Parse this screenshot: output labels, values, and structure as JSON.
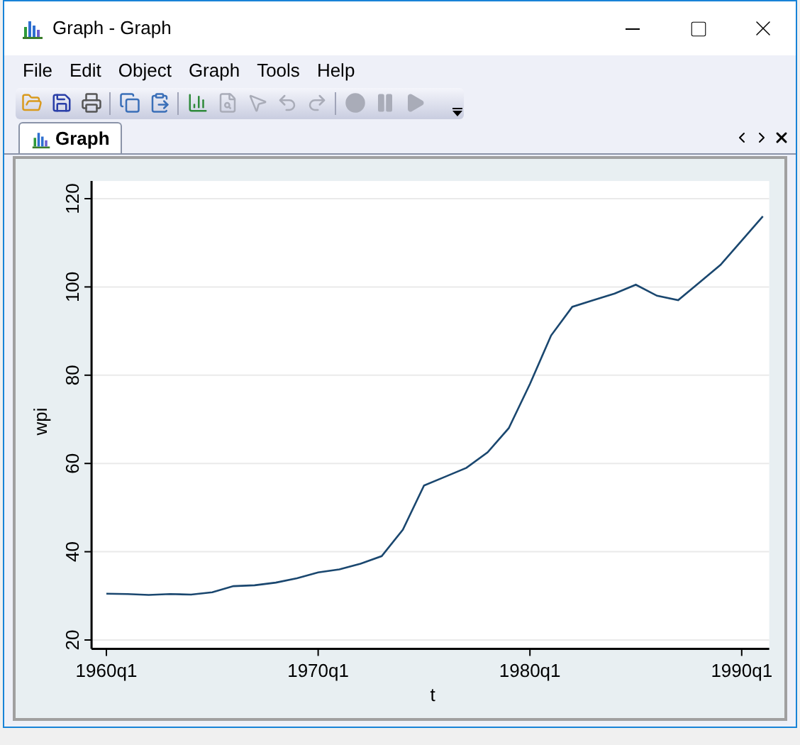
{
  "window": {
    "title": "Graph - Graph"
  },
  "menu": [
    "File",
    "Edit",
    "Object",
    "Graph",
    "Tools",
    "Help"
  ],
  "toolbar": [
    {
      "kind": "open",
      "disabled": false
    },
    {
      "kind": "save",
      "disabled": false
    },
    {
      "kind": "print",
      "disabled": false
    },
    {
      "kind": "sep"
    },
    {
      "kind": "copy",
      "disabled": false
    },
    {
      "kind": "paste",
      "disabled": false
    },
    {
      "kind": "sep"
    },
    {
      "kind": "editor",
      "disabled": false
    },
    {
      "kind": "preview",
      "disabled": true
    },
    {
      "kind": "pointer",
      "disabled": true
    },
    {
      "kind": "undo",
      "disabled": true
    },
    {
      "kind": "redo",
      "disabled": true
    },
    {
      "kind": "sep"
    },
    {
      "kind": "record",
      "disabled": true
    },
    {
      "kind": "pause",
      "disabled": true
    },
    {
      "kind": "play",
      "disabled": true
    }
  ],
  "tabs": [
    {
      "label": "Graph",
      "selected": true
    }
  ],
  "graph": {
    "chart_data": {
      "type": "line",
      "xlabel": "t",
      "ylabel": "wpi",
      "categories": [
        "1960q1",
        null,
        null,
        null,
        null,
        null,
        null,
        null,
        null,
        null,
        "1970q1",
        null,
        null,
        null,
        null,
        null,
        null,
        null,
        null,
        null,
        "1980q1",
        null,
        null,
        null,
        null,
        null,
        null,
        null,
        null,
        null,
        "1990q1",
        null
      ],
      "series": [
        {
          "color": "#1a476f",
          "values": [
            30.5,
            30.4,
            30.2,
            30.4,
            30.3,
            30.8,
            32.2,
            32.4,
            33,
            34,
            35.3,
            36,
            37.3,
            39,
            45,
            55,
            57,
            59,
            62.5,
            68,
            78,
            89,
            95.5,
            97,
            98.5,
            100.5,
            98,
            97,
            101,
            105,
            110.5,
            116
          ]
        }
      ],
      "ylim": [
        18,
        124
      ],
      "grid": true,
      "yticks": [
        20,
        40,
        60,
        80,
        100,
        120
      ]
    }
  }
}
